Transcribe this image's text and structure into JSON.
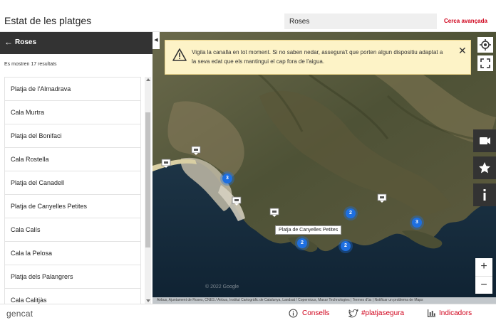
{
  "header": {
    "title": "Estat de les platges",
    "search_value": "Roses",
    "advanced_search": "Cerca avançada"
  },
  "sidebar": {
    "back_label": "Roses",
    "result_count": "Es mostren 17 resultats",
    "results": [
      "Platja de l'Almadrava",
      "Cala Murtra",
      "Platja del Bonifaci",
      "Cala Rostella",
      "Platja del Canadell",
      "Platja de Canyelles Petites",
      "Cala Calís",
      "Cala la Pelosa",
      "Platja dels Palangrers",
      "Cala Calitjàs"
    ]
  },
  "map": {
    "alert_text": "Vigila la canalla en tot moment. Si no saben nedar, assegura't que porten algun dispositiu adaptat a la seva edat que els mantingui el cap fora de l'aigua.",
    "tooltip": "Platja de Canyelles Petites",
    "clusters": [
      "3",
      "2",
      "2",
      "2",
      "3"
    ],
    "zoom_in": "+",
    "zoom_out": "−",
    "watermark": "© 2022 Google",
    "attribution": "Airbus, Ajuntament de Roses, CNES / Airbus, Institut Cartogràfic de Catalunya, Landsat / Copernicus, Maxar Technologies | Termes d'ús | Notificar un problema de Maps"
  },
  "footer": {
    "brand": "gencat",
    "links": [
      "Consells",
      "#platjasegura",
      "Indicadors"
    ]
  },
  "colors": {
    "accent": "#d0021b",
    "dark_bar": "#333333",
    "alert_bg": "#fdf3c7",
    "cluster": "#1e6fe0"
  }
}
